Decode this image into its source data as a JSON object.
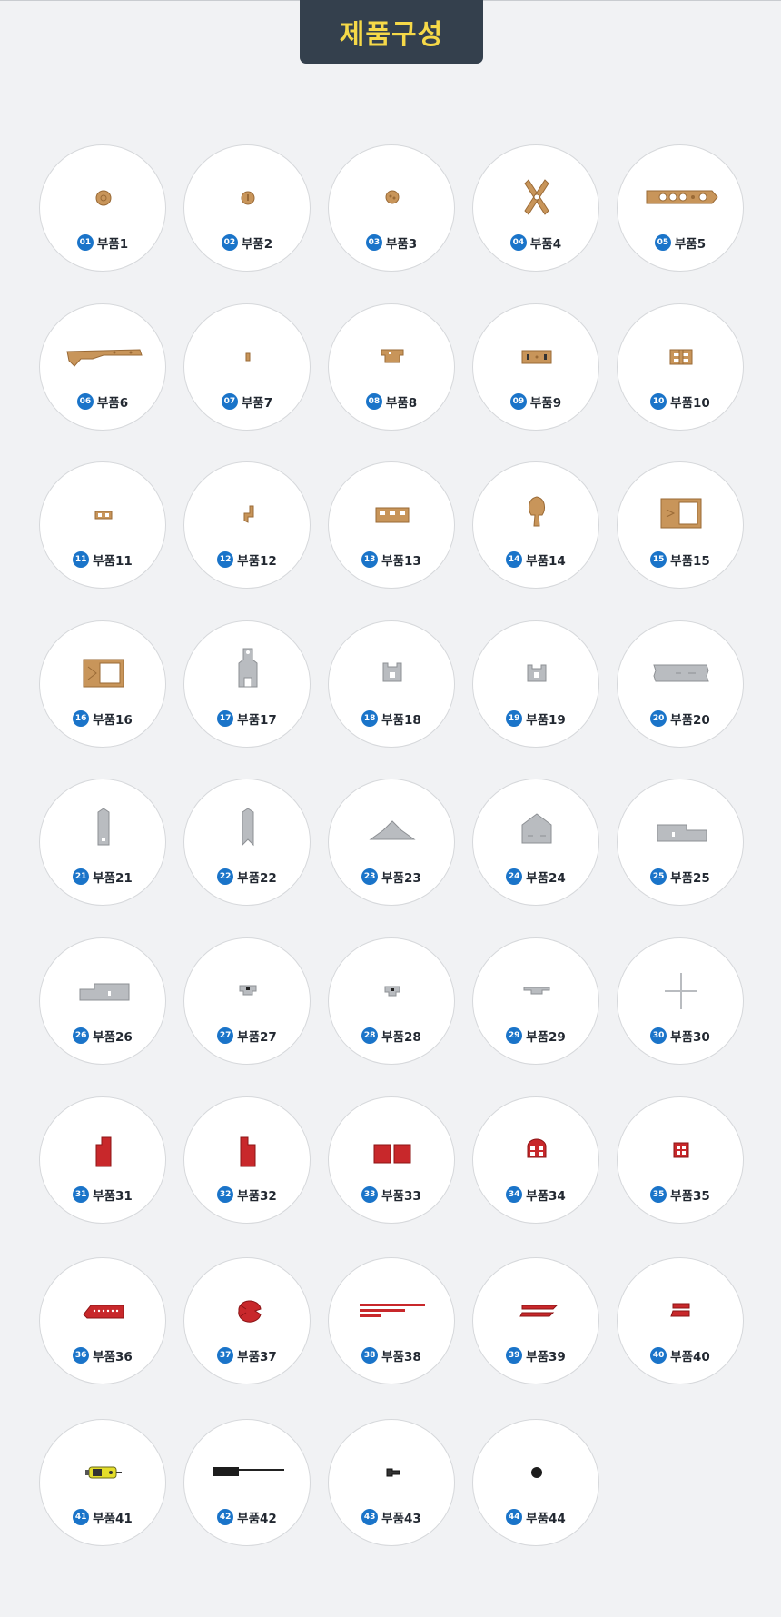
{
  "title": "제품구성",
  "colors": {
    "title_bg": "#34404d",
    "title_text": "#f6d948",
    "badge": "#1a74c9",
    "wood": "#c8955a",
    "grey": "#b9bcc0",
    "red": "#c8282b"
  },
  "parts": [
    {
      "num": "01",
      "name": "부품1",
      "icon": "wood-disc-icon"
    },
    {
      "num": "02",
      "name": "부품2",
      "icon": "wood-disc-icon"
    },
    {
      "num": "03",
      "name": "부품3",
      "icon": "wood-disc-icon"
    },
    {
      "num": "04",
      "name": "부품4",
      "icon": "wood-cross-icon"
    },
    {
      "num": "05",
      "name": "부품5",
      "icon": "wood-bar-holes-icon"
    },
    {
      "num": "06",
      "name": "부품6",
      "icon": "wood-arm-icon"
    },
    {
      "num": "07",
      "name": "부품7",
      "icon": "wood-pin-icon"
    },
    {
      "num": "08",
      "name": "부품8",
      "icon": "wood-bracket-icon"
    },
    {
      "num": "09",
      "name": "부품9",
      "icon": "wood-plate-slots-icon"
    },
    {
      "num": "10",
      "name": "부품10",
      "icon": "wood-fence-icon"
    },
    {
      "num": "11",
      "name": "부품11",
      "icon": "wood-small-bar-icon"
    },
    {
      "num": "12",
      "name": "부품12",
      "icon": "wood-hook-icon"
    },
    {
      "num": "13",
      "name": "부품13",
      "icon": "wood-rail-icon"
    },
    {
      "num": "14",
      "name": "부품14",
      "icon": "wood-tree-icon"
    },
    {
      "num": "15",
      "name": "부품15",
      "icon": "wood-frame-icon"
    },
    {
      "num": "16",
      "name": "부품16",
      "icon": "wood-frame-icon"
    },
    {
      "num": "17",
      "name": "부품17",
      "icon": "grey-tower-icon"
    },
    {
      "num": "18",
      "name": "부품18",
      "icon": "grey-castle-icon"
    },
    {
      "num": "19",
      "name": "부품19",
      "icon": "grey-castle-icon"
    },
    {
      "num": "20",
      "name": "부품20",
      "icon": "grey-panel-icon"
    },
    {
      "num": "21",
      "name": "부품21",
      "icon": "grey-pillar-icon"
    },
    {
      "num": "22",
      "name": "부품22",
      "icon": "grey-pillar-icon"
    },
    {
      "num": "23",
      "name": "부품23",
      "icon": "grey-roof-icon"
    },
    {
      "num": "24",
      "name": "부품24",
      "icon": "grey-house-icon"
    },
    {
      "num": "25",
      "name": "부품25",
      "icon": "grey-wall-icon"
    },
    {
      "num": "26",
      "name": "부품26",
      "icon": "grey-wall-icon"
    },
    {
      "num": "27",
      "name": "부품27",
      "icon": "grey-clip-icon"
    },
    {
      "num": "28",
      "name": "부품28",
      "icon": "grey-clip-icon"
    },
    {
      "num": "29",
      "name": "부품29",
      "icon": "grey-step-icon"
    },
    {
      "num": "30",
      "name": "부품30",
      "icon": "grey-cross-icon"
    },
    {
      "num": "31",
      "name": "부품31",
      "icon": "red-block-icon"
    },
    {
      "num": "32",
      "name": "부품32",
      "icon": "red-block-icon"
    },
    {
      "num": "33",
      "name": "부품33",
      "icon": "red-double-block-icon"
    },
    {
      "num": "34",
      "name": "부품34",
      "icon": "red-arch-window-icon"
    },
    {
      "num": "35",
      "name": "부품35",
      "icon": "red-window-icon"
    },
    {
      "num": "36",
      "name": "부품36",
      "icon": "red-comb-icon"
    },
    {
      "num": "37",
      "name": "부품37",
      "icon": "red-claw-icon"
    },
    {
      "num": "38",
      "name": "부품38",
      "icon": "red-strips-icon"
    },
    {
      "num": "39",
      "name": "부품39",
      "icon": "red-strips-icon"
    },
    {
      "num": "40",
      "name": "부품40",
      "icon": "red-small-strips-icon"
    },
    {
      "num": "41",
      "name": "부품41",
      "icon": "motor-icon"
    },
    {
      "num": "42",
      "name": "부품42",
      "icon": "shaft-icon"
    },
    {
      "num": "43",
      "name": "부품43",
      "icon": "screw-icon"
    },
    {
      "num": "44",
      "name": "부품44",
      "icon": "bead-icon"
    }
  ]
}
